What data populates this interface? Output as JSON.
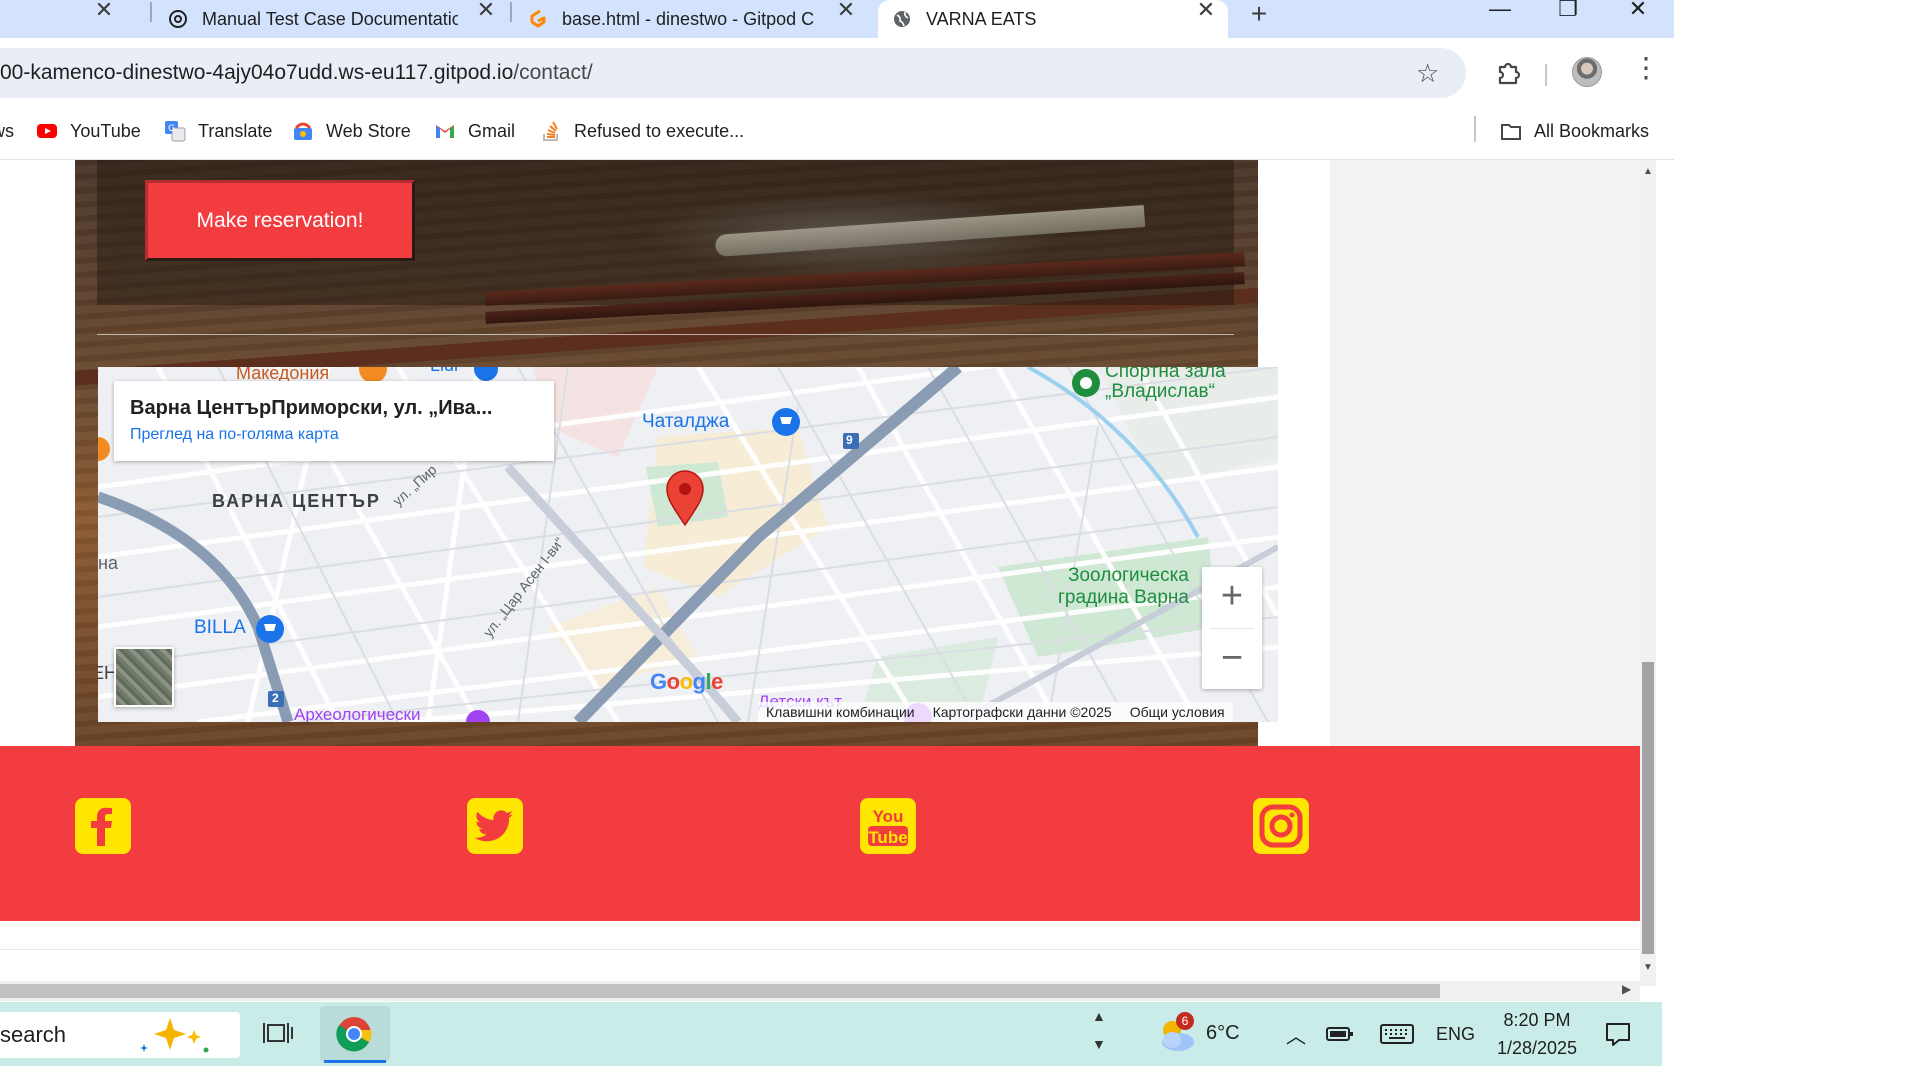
{
  "browser": {
    "tabs": [
      {
        "title": "",
        "close": "✕"
      },
      {
        "title": "Manual Test Case Documentatio",
        "close": "✕"
      },
      {
        "title": "base.html - dinestwo - Gitpod C",
        "close": "✕"
      },
      {
        "title": "VARNA EATS",
        "close": "✕",
        "active": true
      }
    ],
    "new_tab": "+",
    "window_controls": {
      "minimize": "—",
      "restore": "❐",
      "close": "✕"
    },
    "url_host": "00-kamenco-dinestwo-4ajy04o7udd.ws-eu117.gitpod.io",
    "url_path": "/contact/",
    "bookmarks": [
      {
        "label": "ws",
        "icon": "cut-off-icon"
      },
      {
        "label": "YouTube",
        "icon": "youtube-icon"
      },
      {
        "label": "Translate",
        "icon": "translate-icon"
      },
      {
        "label": "Web Store",
        "icon": "webstore-icon"
      },
      {
        "label": "Gmail",
        "icon": "gmail-icon"
      },
      {
        "label": "Refused to execute...",
        "icon": "stackoverflow-icon"
      }
    ],
    "all_bookmarks": "All Bookmarks"
  },
  "page": {
    "reserve_button": "Make reservation!",
    "map": {
      "card_title": "Варна ЦентърПриморски, ул. „Ива...",
      "card_link": "Преглед на по-голяма карта",
      "labels": {
        "makedonia": "Македония",
        "lidl": "Lidl",
        "sport_hall_1": "Спортна зала",
        "sport_hall_2": "„Владислав“",
        "chataldzha": "Чаталджа",
        "varna_center": "ВАРНА ЦЕНТЪР",
        "street_pir": "ул. „Пир",
        "na": "на",
        "billa": "BILLA",
        "street_tsar_asen": "ул. „Цар Асен I-ви“",
        "zoo_1": "Зоологическа",
        "zoo_2": "градина Варна",
        "archaeological": "Археологически",
        "kids_corner": "Детски кът",
        "route_9": "9",
        "route_2": "2",
        "eh": "ЕН"
      },
      "zoom_in": "+",
      "zoom_out": "−",
      "google_logo": "Google",
      "attribution": [
        "Клавишни комбинации",
        "Картографски данни ©2025",
        "Общи условия"
      ]
    },
    "social": [
      "facebook-icon",
      "twitter-icon",
      "youtube-icon",
      "instagram-icon"
    ],
    "colors": {
      "accent": "#f33c3f",
      "social_icon": "#ffe600",
      "link": "#1a73e8"
    }
  },
  "taskbar": {
    "search_text": "search",
    "weather_badge": "6",
    "temperature": "6°C",
    "language": "ENG",
    "time": "8:20 PM",
    "date": "1/28/2025"
  }
}
